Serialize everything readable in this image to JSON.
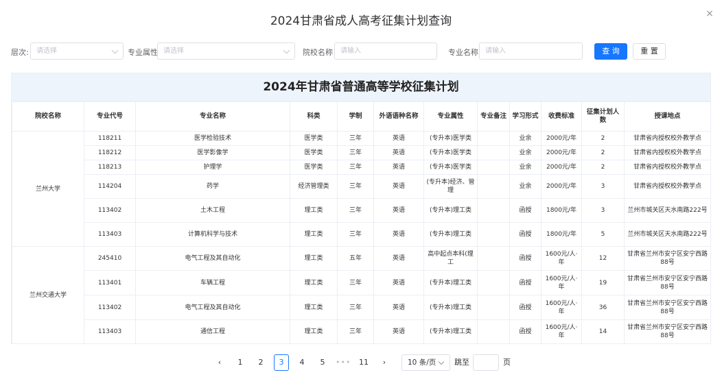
{
  "modal": {
    "title": "2024甘肃省成人高考征集计划查询",
    "close_icon": "×"
  },
  "filters": {
    "level_label": "层次:",
    "level_placeholder": "请选择",
    "major_attr_label": "专业属性",
    "major_attr_placeholder": "请选择",
    "school_label": "院校名称",
    "school_placeholder": "请输入",
    "major_name_label": "专业名称",
    "major_name_placeholder": "请输入",
    "search_label": "查 询",
    "reset_label": "重 置"
  },
  "table": {
    "title": "2024年甘肃省普通高等学校征集计划",
    "columns": [
      "院校名称",
      "专业代号",
      "专业名称",
      "科类",
      "学制",
      "外语语种名称",
      "专业属性",
      "专业备注",
      "学习形式",
      "收费标准",
      "征集计划人数",
      "授课地点"
    ],
    "schools": [
      {
        "name": "兰州大学",
        "rows": [
          [
            "118211",
            "医学检验技术",
            "医学类",
            "三年",
            "英语",
            "(专升本)医学类",
            "",
            "业余",
            "2000元/年",
            "2",
            "甘肃省内授权校外教学点"
          ],
          [
            "118212",
            "医学影像学",
            "医学类",
            "三年",
            "英语",
            "(专升本)医学类",
            "",
            "业余",
            "2000元/年",
            "2",
            "甘肃省内授权校外教学点"
          ],
          [
            "118213",
            "护理学",
            "医学类",
            "三年",
            "英语",
            "(专升本)医学类",
            "",
            "业余",
            "2000元/年",
            "2",
            "甘肃省内授权校外教学点"
          ],
          [
            "114204",
            "药学",
            "经济管理类",
            "三年",
            "英语",
            "(专升本)经济、管理",
            "",
            "业余",
            "2000元/年",
            "3",
            "甘肃省内授权校外教学点"
          ],
          [
            "113402",
            "土木工程",
            "理工类",
            "三年",
            "英语",
            "(专升本)理工类",
            "",
            "函授",
            "1800元/年",
            "3",
            "兰州市城关区天水南路222号"
          ],
          [
            "113403",
            "计算机科学与技术",
            "理工类",
            "三年",
            "英语",
            "(专升本)理工类",
            "",
            "函授",
            "1800元/年",
            "5",
            "兰州市城关区天水南路222号"
          ]
        ]
      },
      {
        "name": "兰州交通大学",
        "rows": [
          [
            "245410",
            "电气工程及其自动化",
            "理工类",
            "五年",
            "英语",
            "高中起点本科(理工",
            "",
            "函授",
            "1600元/人·年",
            "12",
            "甘肃省兰州市安宁区安宁西路88号"
          ],
          [
            "113401",
            "车辆工程",
            "理工类",
            "三年",
            "英语",
            "(专升本)理工类",
            "",
            "函授",
            "1600元/人·年",
            "19",
            "甘肃省兰州市安宁区安宁西路88号"
          ],
          [
            "113402",
            "电气工程及其自动化",
            "理工类",
            "三年",
            "英语",
            "(专升本)理工类",
            "",
            "函授",
            "1600元/人·年",
            "36",
            "甘肃省兰州市安宁区安宁西路88号"
          ],
          [
            "113403",
            "通信工程",
            "理工类",
            "三年",
            "英语",
            "(专升本)理工类",
            "",
            "函授",
            "1600元/人·年",
            "14",
            "甘肃省兰州市安宁区安宁西路88号"
          ]
        ]
      }
    ]
  },
  "pagination": {
    "prev_icon": "‹",
    "next_icon": "›",
    "pages": [
      "1",
      "2",
      "3",
      "4",
      "5"
    ],
    "current_page": "3",
    "ellipsis": "•••",
    "last_page": "11",
    "page_size": "10 条/页",
    "jump_label": "跳至",
    "page_suffix": "页"
  }
}
